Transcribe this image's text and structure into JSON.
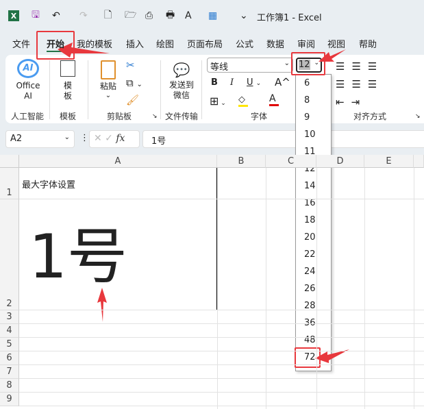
{
  "window": {
    "title": "工作簿1  -  Excel"
  },
  "quick_access": [
    {
      "icon": "excel-logo-icon",
      "glyph": "X"
    },
    {
      "icon": "save-icon",
      "glyph": "🖫"
    },
    {
      "icon": "undo-icon",
      "glyph": "↶"
    },
    {
      "icon": "redo-icon",
      "glyph": "↷"
    },
    {
      "icon": "new-file-icon",
      "glyph": "🗋"
    },
    {
      "icon": "open-folder-icon",
      "glyph": "🗁"
    },
    {
      "icon": "print-preview-icon",
      "glyph": "⎙"
    },
    {
      "icon": "print-icon",
      "glyph": "🖶"
    },
    {
      "icon": "font-color-icon",
      "glyph": "A"
    },
    {
      "icon": "table-icon",
      "glyph": "▦"
    },
    {
      "icon": "customize-icon",
      "glyph": "⌄"
    }
  ],
  "tabs": [
    "文件",
    "开始",
    "我的模板",
    "插入",
    "绘图",
    "页面布局",
    "公式",
    "数据",
    "审阅",
    "视图",
    "帮助"
  ],
  "active_tab": "开始",
  "ribbon": {
    "office_ai": "Office AI",
    "ai_icon_text": "AI",
    "template": "模板",
    "paste": "粘贴",
    "send_wechat": "发送到微信",
    "groups": [
      "人工智能",
      "模板",
      "剪贴板",
      "文件传输",
      "字体",
      "对齐方式"
    ],
    "font_name": "等线",
    "font_size": "12",
    "bold": "B",
    "italic": "I",
    "underline": "U",
    "grow_font": "A^",
    "font_color": "A",
    "colors": {
      "highlight": "#ffe600",
      "font": "#e00000",
      "accent": "#217346",
      "callout": "#e8383d"
    }
  },
  "formula_bar": {
    "name_box": "A2",
    "fx": "fx",
    "value": "1号"
  },
  "columns": [
    "A",
    "B",
    "C",
    "D",
    "E"
  ],
  "rows": [
    "1",
    "2",
    "3",
    "4",
    "5",
    "6",
    "7",
    "8",
    "9"
  ],
  "cells": {
    "A1": "最大字体设置",
    "A2": "1号"
  },
  "font_size_dropdown": [
    "6",
    "8",
    "9",
    "10",
    "11",
    "12",
    "14",
    "16",
    "18",
    "20",
    "22",
    "24",
    "26",
    "28",
    "36",
    "48",
    "72"
  ]
}
